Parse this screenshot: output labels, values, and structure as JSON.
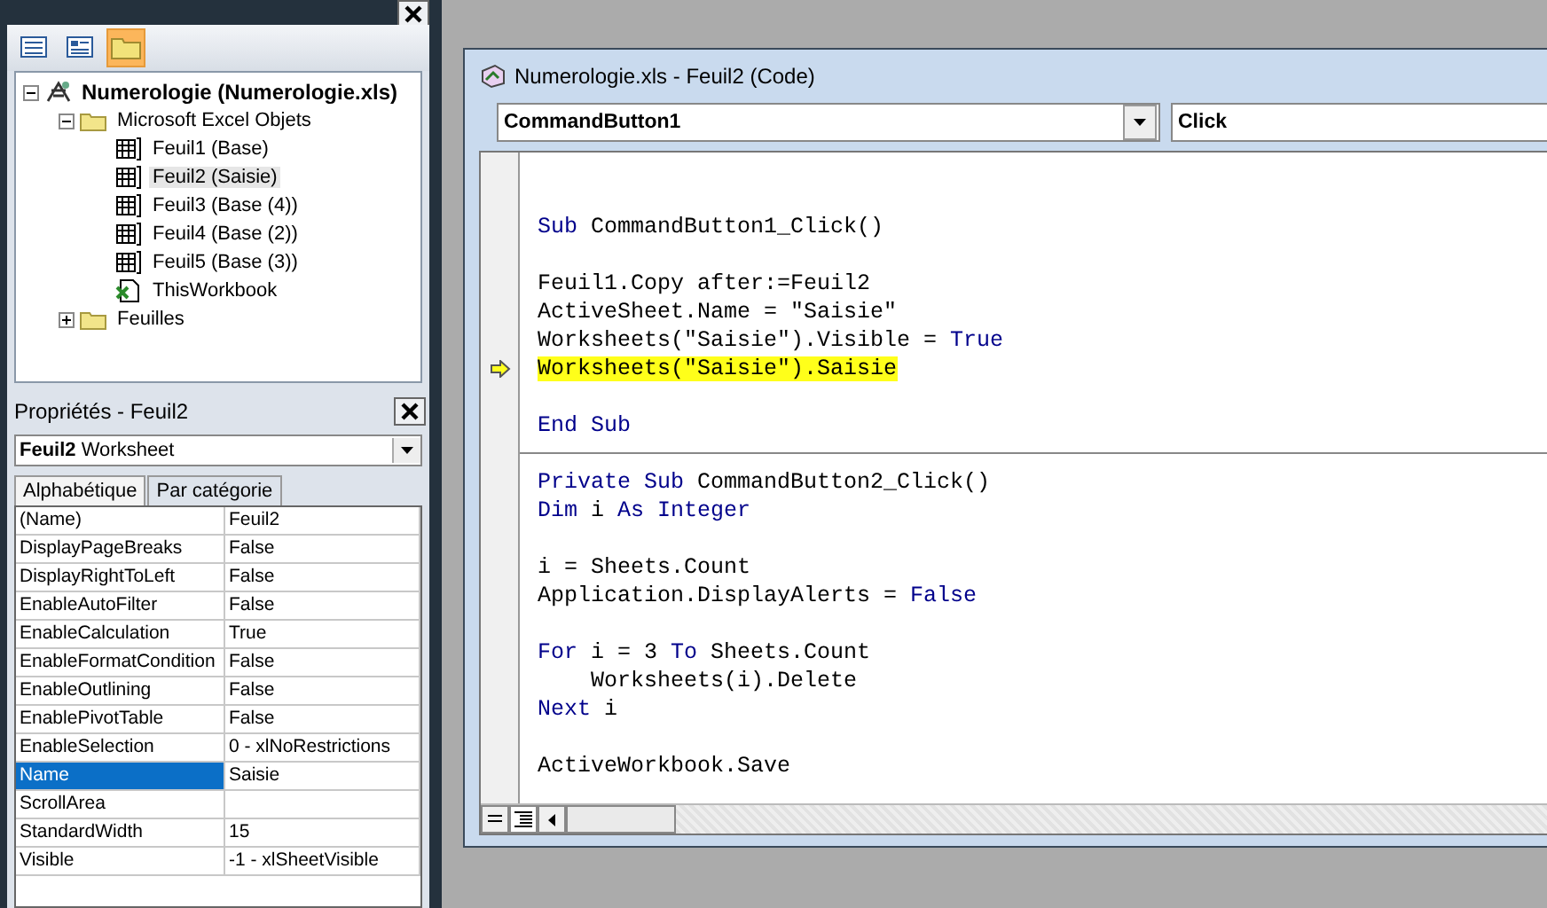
{
  "project": {
    "toolbar": [
      {
        "kind": "code",
        "selected": false
      },
      {
        "kind": "object",
        "selected": false
      },
      {
        "kind": "folders",
        "selected": true
      }
    ],
    "tree": [
      {
        "label": "Numerologie (Numerologie.xls)",
        "kind": "project",
        "expanded": true,
        "selected": false,
        "children": [
          {
            "label": "Microsoft Excel Objets",
            "kind": "folder",
            "expanded": true,
            "selected": false,
            "children": [
              {
                "label": "Feuil1 (Base)",
                "kind": "sheet",
                "selected": false
              },
              {
                "label": "Feuil2 (Saisie)",
                "kind": "sheet",
                "selected": true
              },
              {
                "label": "Feuil3 (Base (4))",
                "kind": "sheet",
                "selected": false
              },
              {
                "label": "Feuil4 (Base (2))",
                "kind": "sheet",
                "selected": false
              },
              {
                "label": "Feuil5 (Base (3))",
                "kind": "sheet",
                "selected": false
              },
              {
                "label": "ThisWorkbook",
                "kind": "workbook",
                "selected": false
              }
            ]
          },
          {
            "label": "Feuilles",
            "kind": "folder",
            "expanded": false,
            "selected": false
          }
        ]
      }
    ]
  },
  "properties": {
    "title": "Propriétés - Feuil2",
    "object_name": "Feuil2",
    "object_type": "Worksheet",
    "tabs": [
      {
        "label": "Alphabétique",
        "selected": true
      },
      {
        "label": "Par catégorie",
        "selected": false
      }
    ],
    "rows": [
      {
        "name": "(Name)",
        "value": "Feuil2",
        "selected": false
      },
      {
        "name": "DisplayPageBreaks",
        "value": "False",
        "selected": false
      },
      {
        "name": "DisplayRightToLeft",
        "value": "False",
        "selected": false
      },
      {
        "name": "EnableAutoFilter",
        "value": "False",
        "selected": false
      },
      {
        "name": "EnableCalculation",
        "value": "True",
        "selected": false
      },
      {
        "name": "EnableFormatCondition",
        "value": "False",
        "selected": false
      },
      {
        "name": "EnableOutlining",
        "value": "False",
        "selected": false
      },
      {
        "name": "EnablePivotTable",
        "value": "False",
        "selected": false
      },
      {
        "name": "EnableSelection",
        "value": "0 - xlNoRestrictions",
        "selected": false
      },
      {
        "name": "Name",
        "value": "Saisie",
        "selected": true
      },
      {
        "name": "ScrollArea",
        "selected": false
      },
      {
        "name": "StandardWidth",
        "value": "15",
        "selected": false
      },
      {
        "name": "Visible",
        "value": "-1 - xlSheetVisible",
        "selected": false
      }
    ]
  },
  "code_window": {
    "title": "Numerologie.xls - Feuil2 (Code)",
    "object": "CommandButton1",
    "procedure": "Click",
    "lines": [
      {
        "kind": "blank"
      },
      {
        "kind": "blank"
      },
      {
        "kind": "code",
        "highlighted": false,
        "tokens": [
          {
            "text": "Sub",
            "kind": "keyword"
          },
          {
            "text": " CommandButton1_Click()",
            "kind": "plain"
          }
        ]
      },
      {
        "kind": "blank"
      },
      {
        "kind": "code",
        "highlighted": false,
        "tokens": [
          {
            "text": "Feuil1.Copy after:=Feuil2",
            "kind": "plain"
          }
        ]
      },
      {
        "kind": "code",
        "highlighted": false,
        "tokens": [
          {
            "text": "ActiveSheet.Name = \"Saisie\"",
            "kind": "plain"
          }
        ]
      },
      {
        "kind": "code",
        "highlighted": false,
        "tokens": [
          {
            "text": "Worksheets(\"Saisie\").Visible = ",
            "kind": "plain"
          },
          {
            "text": "True",
            "kind": "keyword"
          }
        ]
      },
      {
        "kind": "code",
        "highlighted": true,
        "tokens": [
          {
            "text": "Worksheets(\"Saisie\").Saisie",
            "kind": "plain"
          }
        ]
      },
      {
        "kind": "blank"
      },
      {
        "kind": "code",
        "highlighted": false,
        "tokens": [
          {
            "text": "End Sub",
            "kind": "keyword"
          }
        ]
      },
      {
        "kind": "separator"
      },
      {
        "kind": "code",
        "highlighted": false,
        "tokens": [
          {
            "text": "Private Sub",
            "kind": "keyword"
          },
          {
            "text": " CommandButton2_Click()",
            "kind": "plain"
          }
        ]
      },
      {
        "kind": "code",
        "highlighted": false,
        "tokens": [
          {
            "text": "Dim",
            "kind": "keyword"
          },
          {
            "text": " i ",
            "kind": "plain"
          },
          {
            "text": "As Integer",
            "kind": "keyword"
          }
        ]
      },
      {
        "kind": "blank"
      },
      {
        "kind": "code",
        "highlighted": false,
        "tokens": [
          {
            "text": "i = Sheets.Count",
            "kind": "plain"
          }
        ]
      },
      {
        "kind": "code",
        "highlighted": false,
        "tokens": [
          {
            "text": "Application.DisplayAlerts = ",
            "kind": "plain"
          },
          {
            "text": "False",
            "kind": "keyword"
          }
        ]
      },
      {
        "kind": "blank"
      },
      {
        "kind": "code",
        "highlighted": false,
        "tokens": [
          {
            "text": "For",
            "kind": "keyword"
          },
          {
            "text": " i = 3 ",
            "kind": "plain"
          },
          {
            "text": "To",
            "kind": "keyword"
          },
          {
            "text": " Sheets.Count",
            "kind": "plain"
          }
        ]
      },
      {
        "kind": "code",
        "highlighted": false,
        "tokens": [
          {
            "text": "    Worksheets(i).Delete",
            "kind": "plain"
          }
        ]
      },
      {
        "kind": "code",
        "highlighted": false,
        "tokens": [
          {
            "text": "Next",
            "kind": "keyword"
          },
          {
            "text": " i",
            "kind": "plain"
          }
        ]
      },
      {
        "kind": "blank"
      },
      {
        "kind": "code",
        "highlighted": false,
        "tokens": [
          {
            "text": "ActiveWorkbook.Save",
            "kind": "plain"
          }
        ]
      }
    ]
  }
}
